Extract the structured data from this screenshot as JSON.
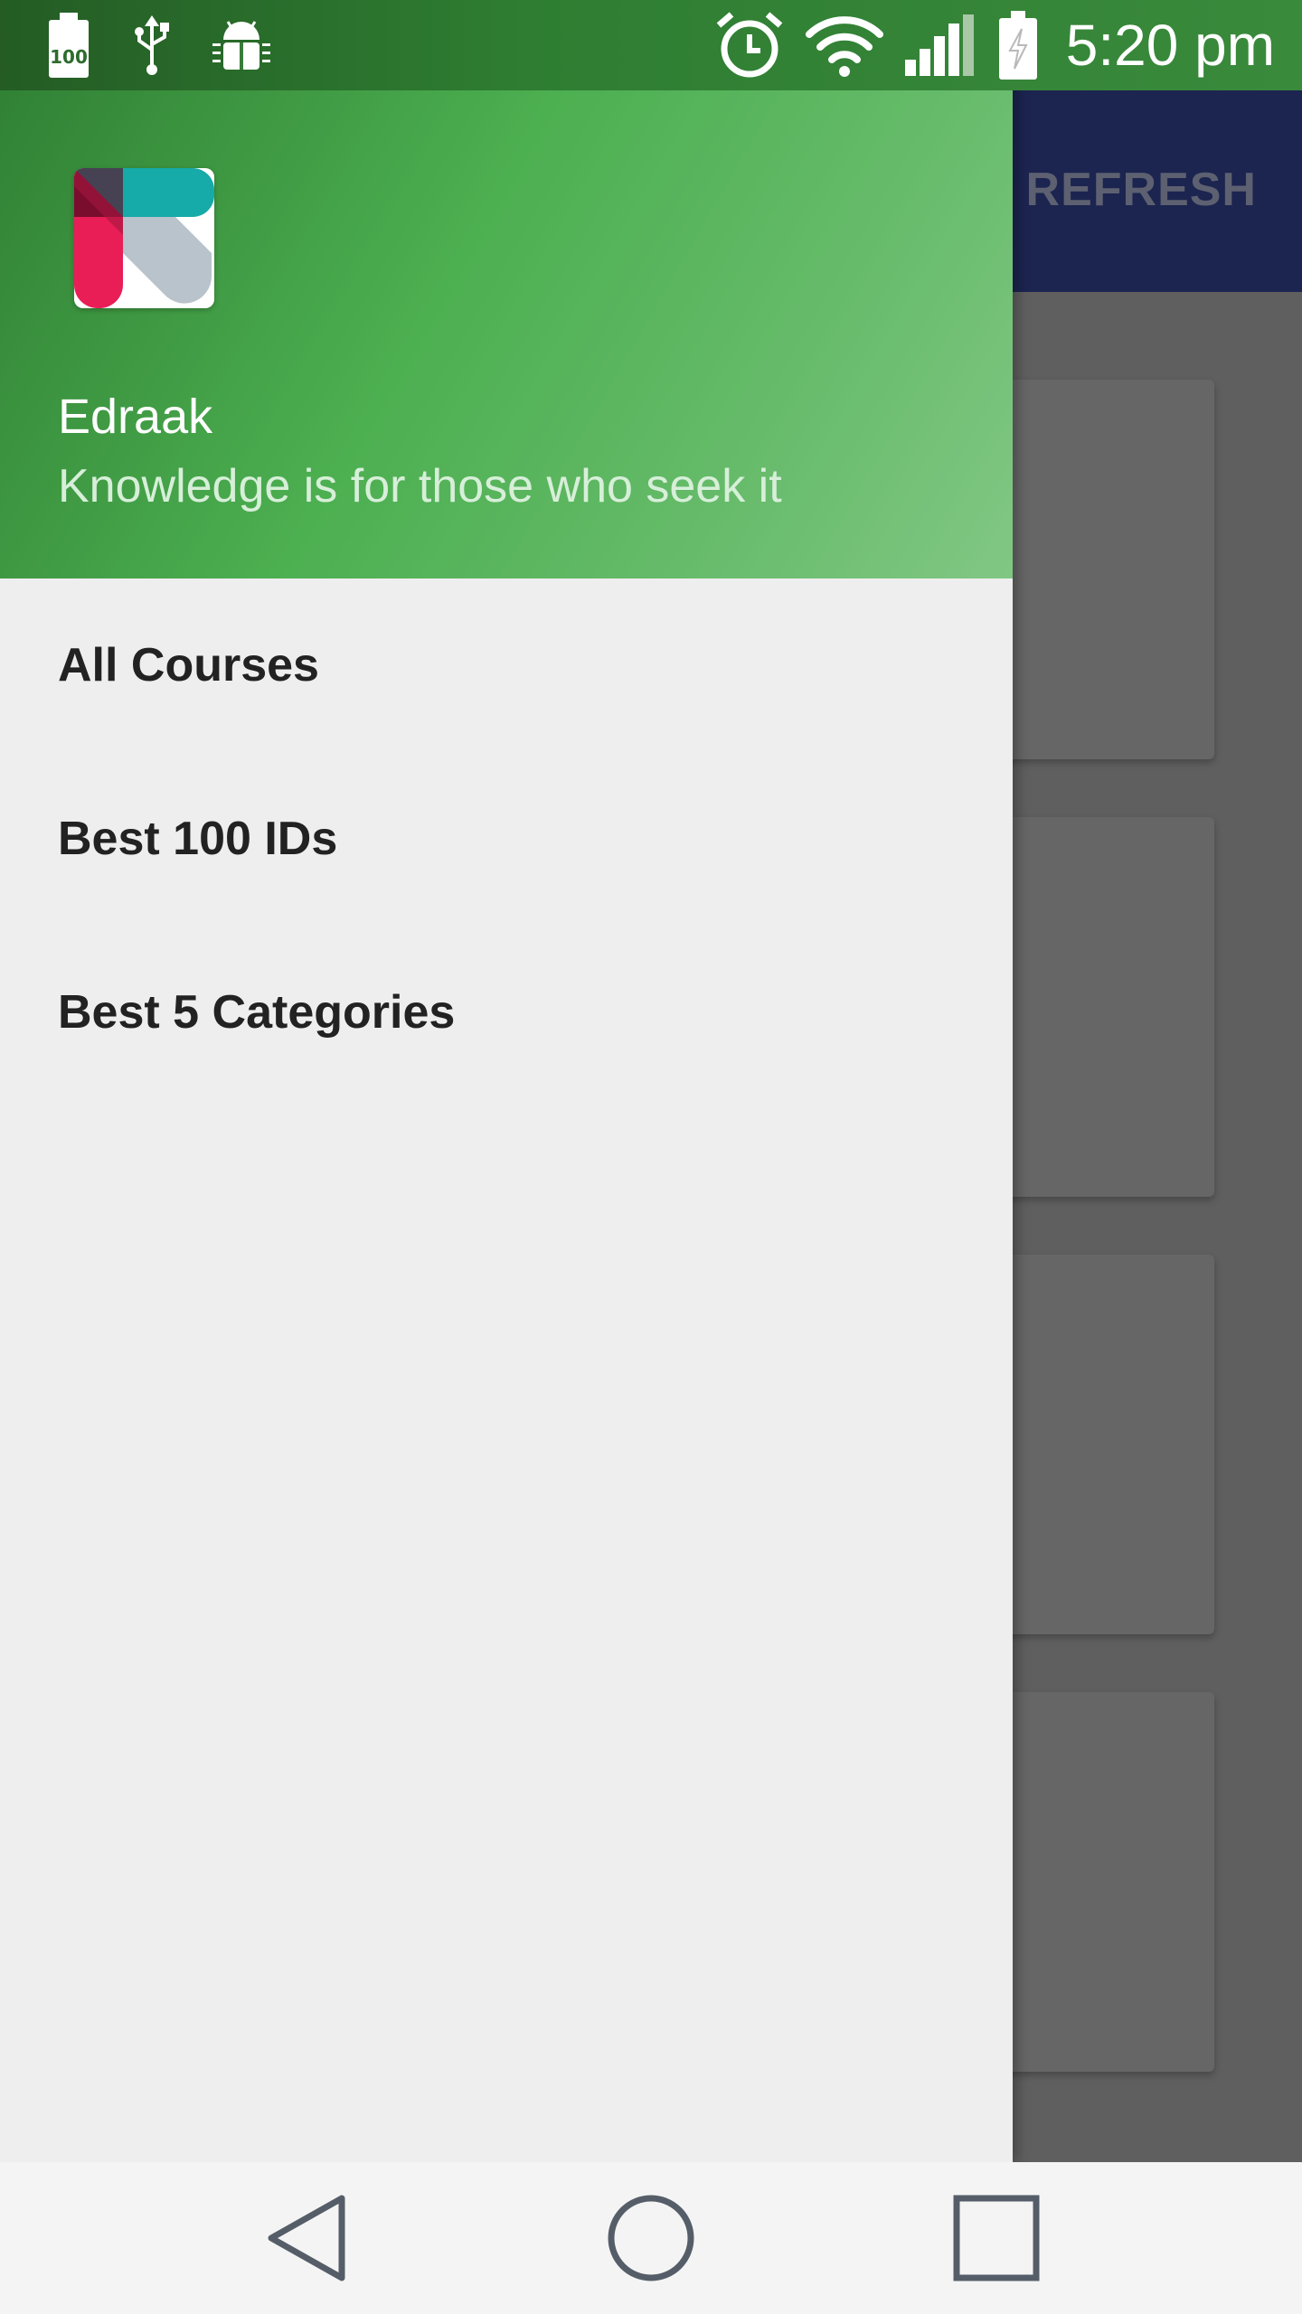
{
  "status_bar": {
    "time": "5:20 pm",
    "battery_level_label": "100",
    "icons": [
      "battery-100-icon",
      "usb-icon",
      "android-debug-icon",
      "alarm-icon",
      "wifi-icon",
      "signal-icon",
      "battery-charging-icon"
    ]
  },
  "app_bar": {
    "action_label": "REFRESH",
    "background_color": "#1c2450"
  },
  "drawer": {
    "header": {
      "title": "Edraak",
      "subtitle": "Knowledge is for those who seek it",
      "logo_icon": "edraak-logo-icon"
    },
    "menu": [
      {
        "label": "All Courses"
      },
      {
        "label": "Best 100 IDs"
      },
      {
        "label": "Best 5 Categories"
      }
    ],
    "header_color": "#4caf50"
  },
  "nav_bar": {
    "buttons": [
      "back-icon",
      "home-icon",
      "recents-icon"
    ]
  }
}
